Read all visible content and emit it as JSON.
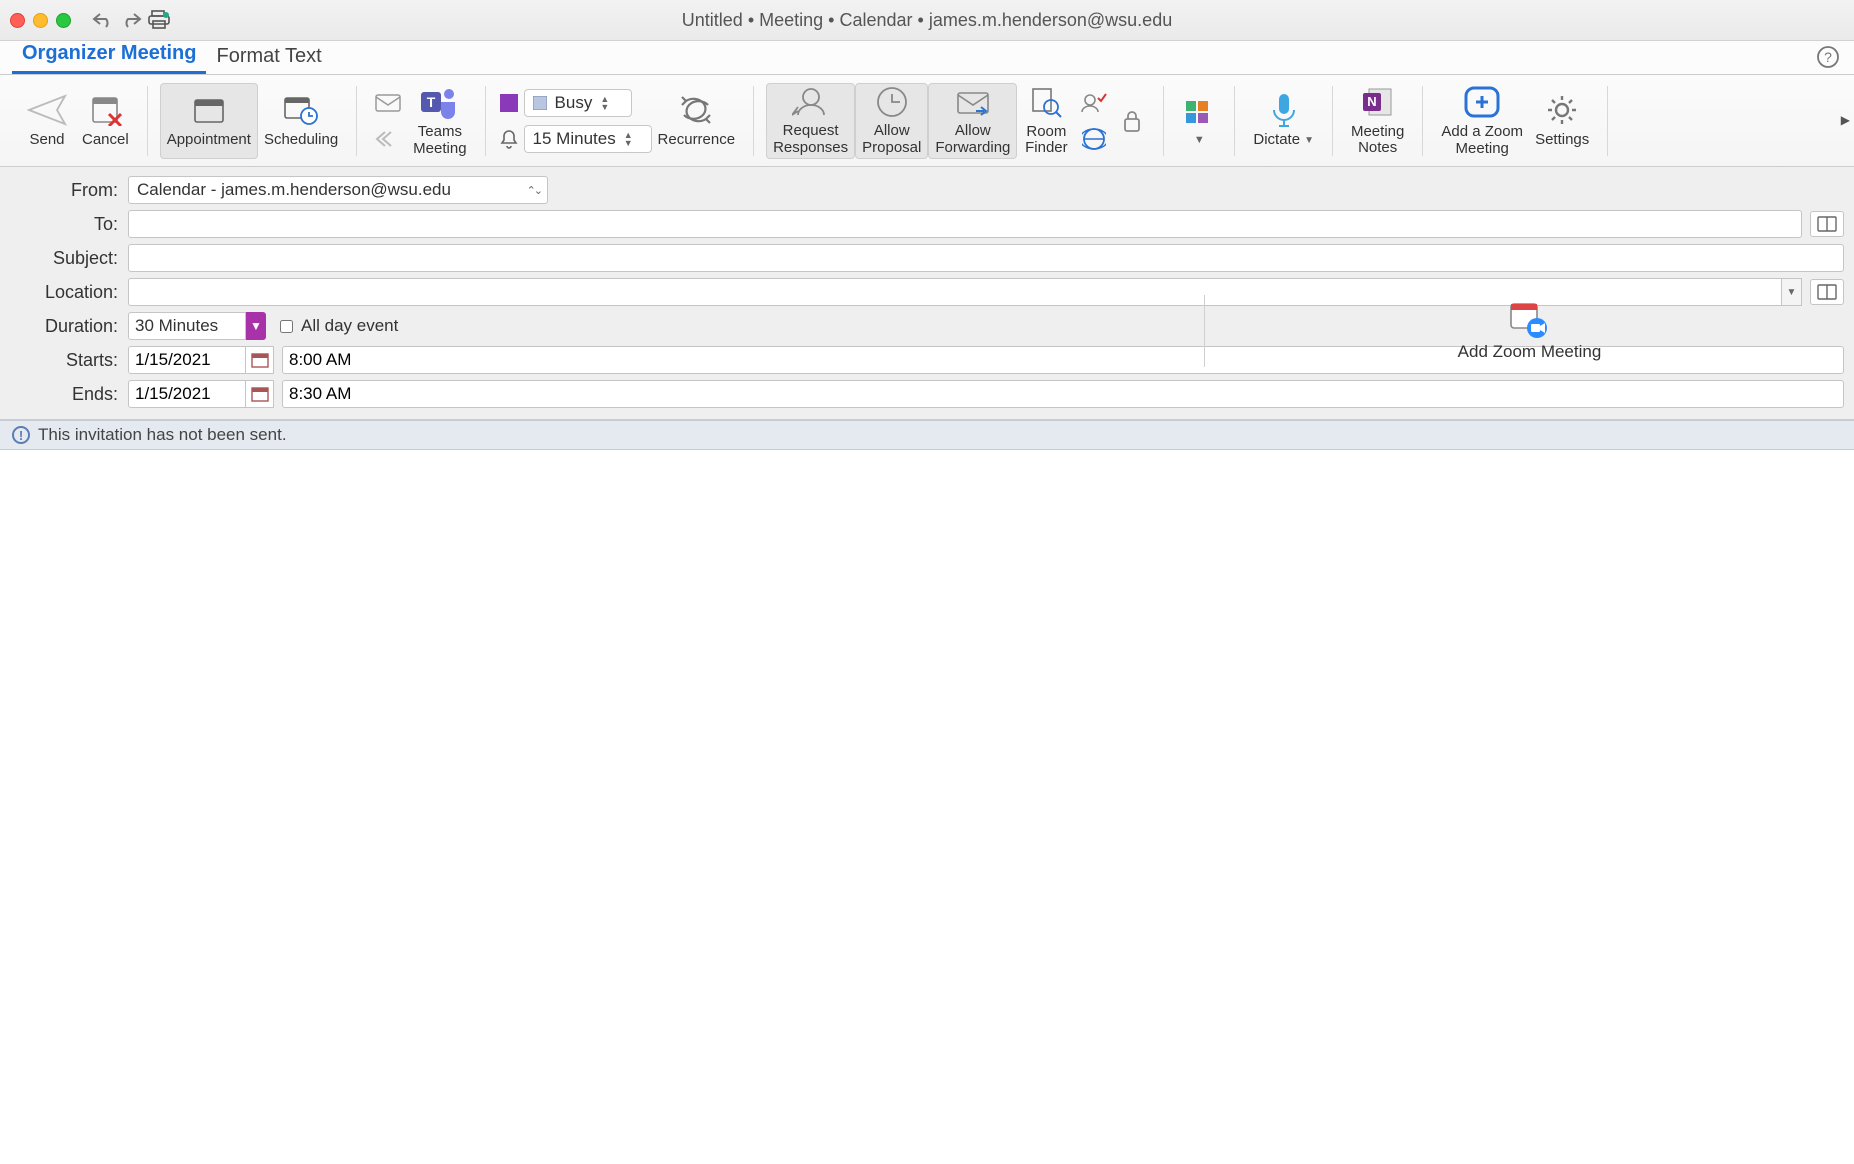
{
  "window": {
    "title": "Untitled • Meeting • Calendar • james.m.henderson@wsu.edu"
  },
  "tabs": {
    "organizer": "Organizer Meeting",
    "format": "Format Text"
  },
  "ribbon": {
    "send": "Send",
    "cancel": "Cancel",
    "appointment": "Appointment",
    "scheduling": "Scheduling",
    "teams": "Teams\nMeeting",
    "status_value": "Busy",
    "reminder_value": "15 Minutes",
    "recurrence": "Recurrence",
    "request_responses": "Request\nResponses",
    "allow_proposal": "Allow\nProposal",
    "allow_forwarding": "Allow\nForwarding",
    "room_finder": "Room\nFinder",
    "dictate": "Dictate",
    "meeting_notes": "Meeting\nNotes",
    "add_zoom": "Add a Zoom\nMeeting",
    "settings": "Settings"
  },
  "form": {
    "from_label": "From:",
    "from_value": "Calendar - james.m.henderson@wsu.edu",
    "to_label": "To:",
    "to_value": "",
    "subject_label": "Subject:",
    "subject_value": "",
    "location_label": "Location:",
    "location_value": "",
    "duration_label": "Duration:",
    "duration_value": "30 Minutes",
    "allday_label": "All day event",
    "starts_label": "Starts:",
    "starts_date": "1/15/2021",
    "starts_time": "8:00 AM",
    "ends_label": "Ends:",
    "ends_date": "1/15/2021",
    "ends_time": "8:30 AM",
    "zoom_button": "Add Zoom Meeting"
  },
  "infobar": {
    "message": "This invitation has not been sent."
  }
}
